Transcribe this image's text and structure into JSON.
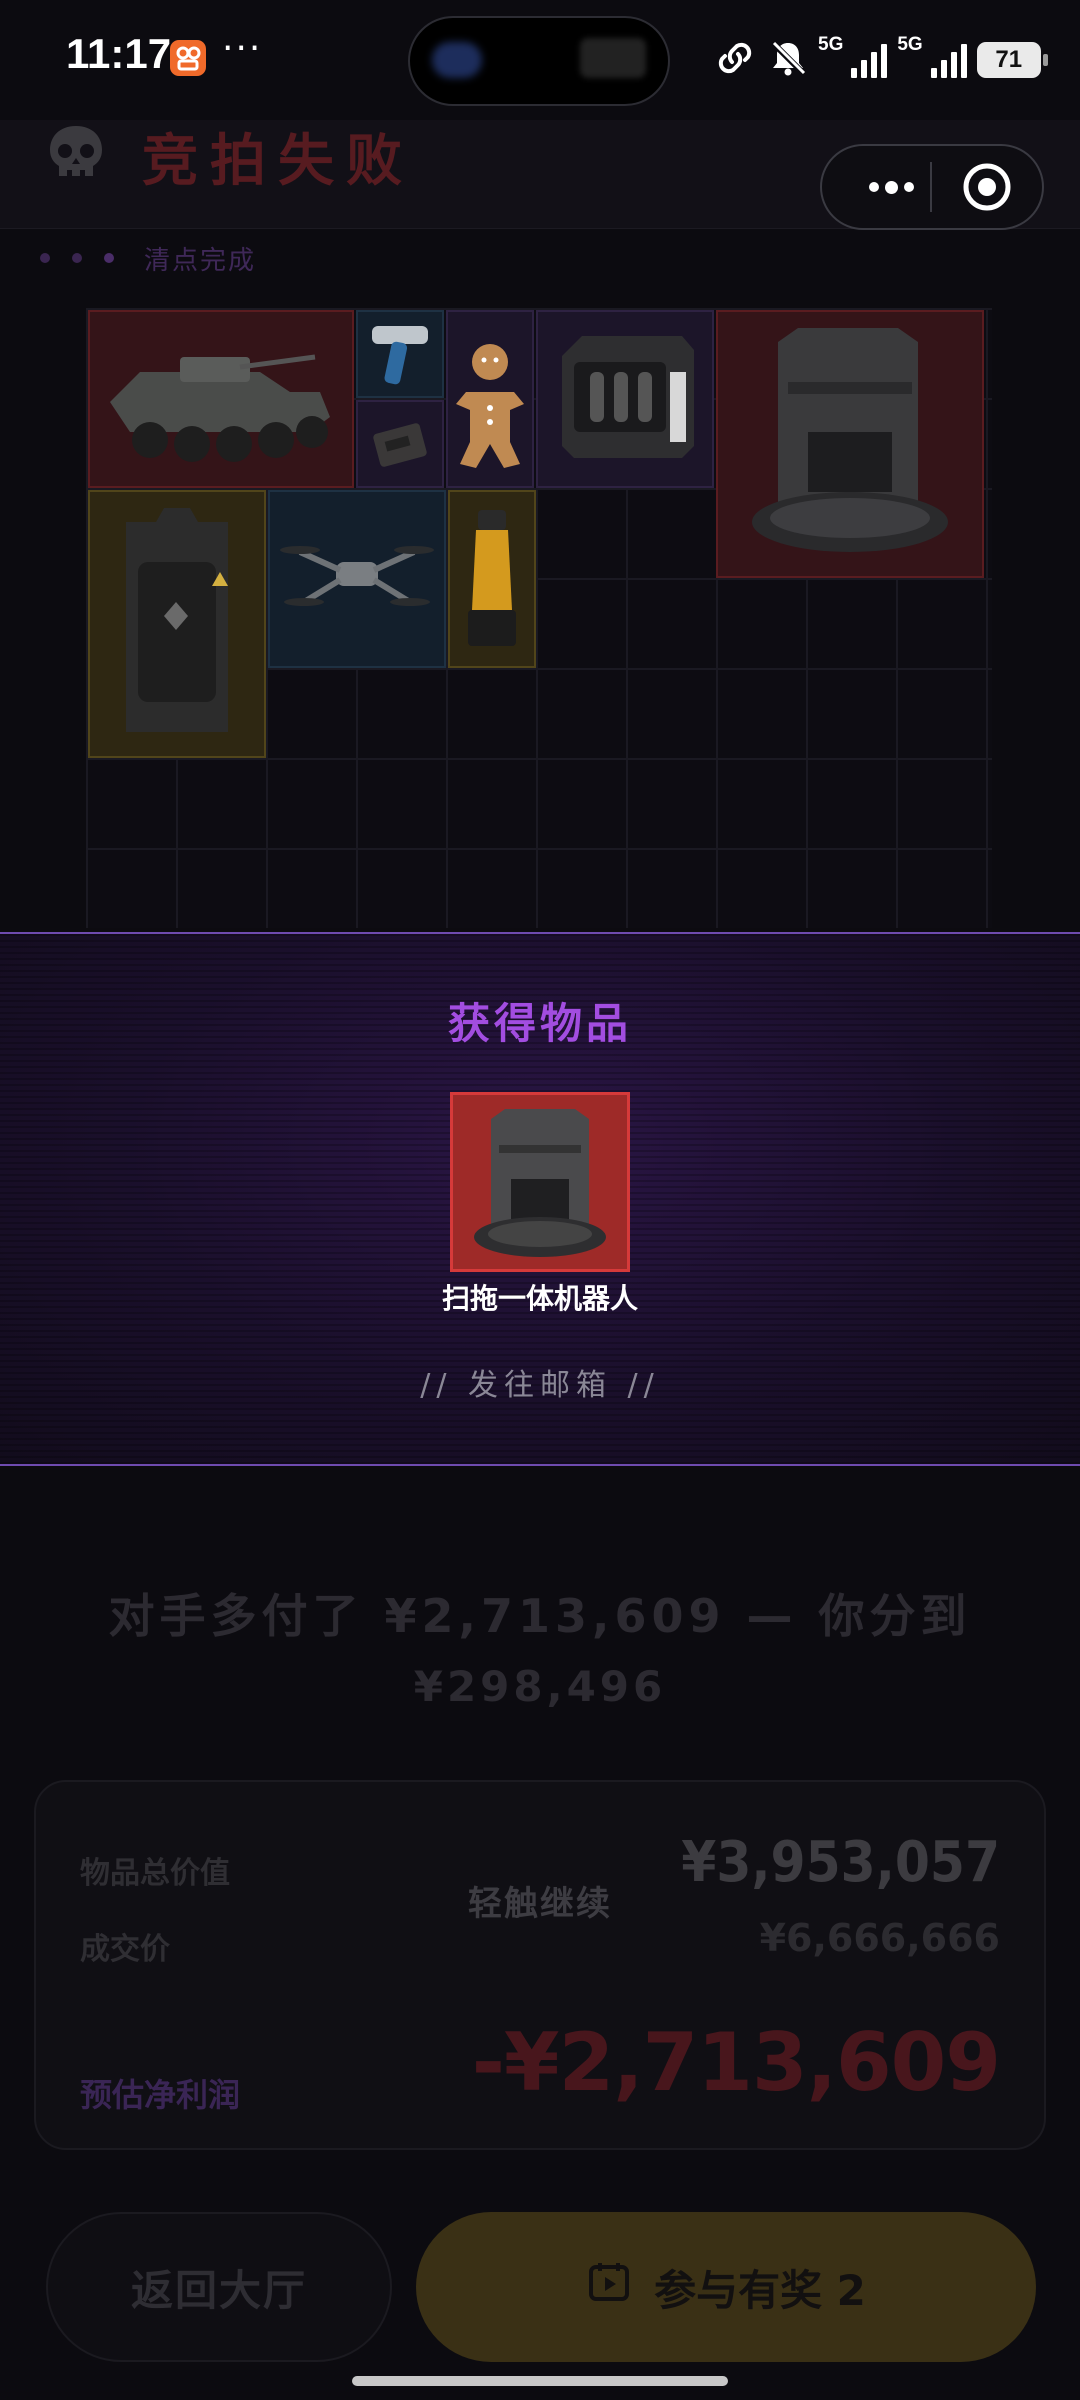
{
  "status_bar": {
    "time": "11:17",
    "more": "···",
    "network_1": "5G",
    "network_2": "5G",
    "battery": "71"
  },
  "header": {
    "title": "竞拍失败",
    "progress_label": "清点完成"
  },
  "grid": {
    "items": [
      {
        "name": "armored-vehicle",
        "rarity": "red"
      },
      {
        "name": "thermometer-gun",
        "rarity": "blue"
      },
      {
        "name": "gingerbread-man",
        "rarity": "purple"
      },
      {
        "name": "small-device",
        "rarity": "purple"
      },
      {
        "name": "coffee-machine",
        "rarity": "purple"
      },
      {
        "name": "robot-vacuum-station",
        "rarity": "red"
      },
      {
        "name": "power-station",
        "rarity": "gold"
      },
      {
        "name": "drone",
        "rarity": "blue"
      },
      {
        "name": "juicer-bottle",
        "rarity": "gold"
      }
    ]
  },
  "acquired": {
    "title": "获得物品",
    "item_name": "扫拖一体机器人",
    "destination": "// 发往邮箱 //"
  },
  "result": {
    "line1": "对手多付了 ¥2,713,609 — 你分到",
    "line2": "¥298,496"
  },
  "summary": {
    "total_value_label": "物品总价值",
    "total_value": "¥3,953,057",
    "deal_price_label": "成交价",
    "deal_price": "¥6,666,666",
    "profit_label": "预估净利润",
    "profit": "-¥2,713,609",
    "tap_hint": "轻触继续"
  },
  "buttons": {
    "lobby": "返回大厅",
    "reward": "参与有奖 2"
  },
  "colors": {
    "accent_purple": "#a24de0",
    "fail_red": "#571b20",
    "rarity_red": "#d63a3a",
    "reward_gold": "#3a3015"
  }
}
